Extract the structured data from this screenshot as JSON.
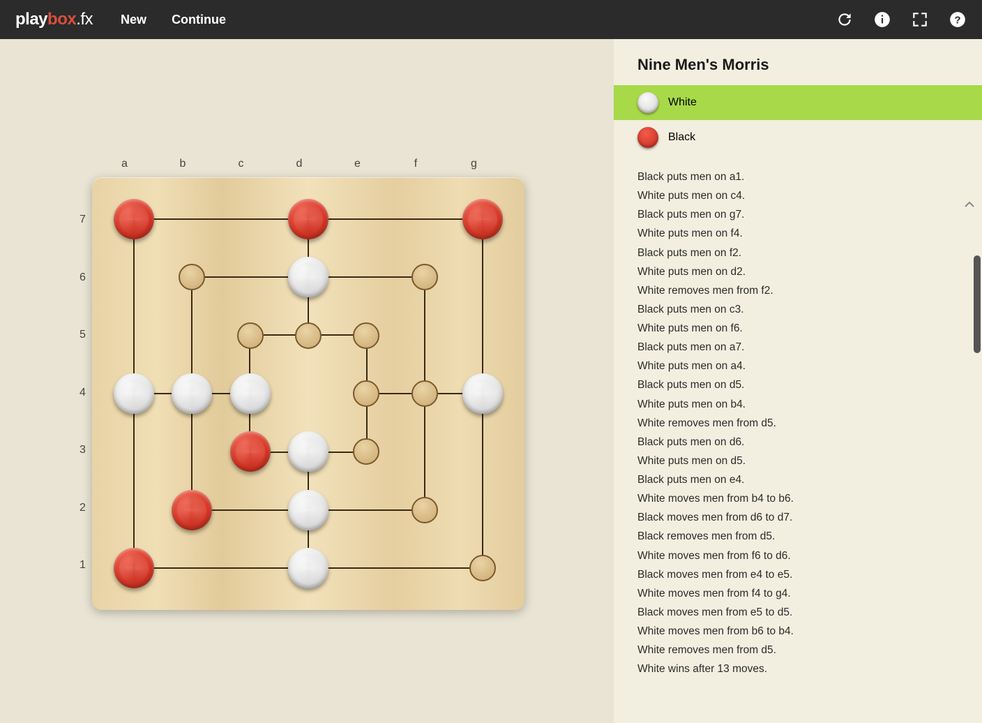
{
  "header": {
    "logo_play": "play",
    "logo_box": "box",
    "logo_fx": ".fx",
    "new_label": "New",
    "continue_label": "Continue"
  },
  "sidebar": {
    "title": "Nine Men's Morris",
    "white_label": "White",
    "black_label": "Black",
    "active_player": "white"
  },
  "log": [
    "Black puts men on a1.",
    "White puts men on c4.",
    "Black puts men on g7.",
    "White puts men on f4.",
    "Black puts men on f2.",
    "White puts men on d2.",
    "White removes men from f2.",
    "Black puts men on c3.",
    "White puts men on f6.",
    "Black puts men on a7.",
    "White puts men on a4.",
    "Black puts men on d5.",
    "White puts men on b4.",
    "White removes men from d5.",
    "Black puts men on d6.",
    "White puts men on d5.",
    "Black puts men on e4.",
    "White moves men from b4 to b6.",
    "Black moves men from d6 to d7.",
    "Black removes men from d5.",
    "White moves men from f6 to d6.",
    "Black moves men from e4 to e5.",
    "White moves men from f4 to g4.",
    "Black moves men from e5 to d5.",
    "White moves men from b6 to b4.",
    "White removes men from d5.",
    "White wins after 13 moves."
  ],
  "board": {
    "cols": [
      "a",
      "b",
      "c",
      "d",
      "e",
      "f",
      "g"
    ],
    "rows": [
      "7",
      "6",
      "5",
      "4",
      "3",
      "2",
      "1"
    ],
    "points": [
      {
        "id": "a7",
        "col": 0,
        "row": 0
      },
      {
        "id": "d7",
        "col": 3,
        "row": 0
      },
      {
        "id": "g7",
        "col": 6,
        "row": 0
      },
      {
        "id": "b6",
        "col": 1,
        "row": 1
      },
      {
        "id": "d6",
        "col": 3,
        "row": 1
      },
      {
        "id": "f6",
        "col": 5,
        "row": 1
      },
      {
        "id": "c5",
        "col": 2,
        "row": 2
      },
      {
        "id": "d5",
        "col": 3,
        "row": 2
      },
      {
        "id": "e5",
        "col": 4,
        "row": 2
      },
      {
        "id": "a4",
        "col": 0,
        "row": 3
      },
      {
        "id": "b4",
        "col": 1,
        "row": 3
      },
      {
        "id": "c4",
        "col": 2,
        "row": 3
      },
      {
        "id": "e4",
        "col": 4,
        "row": 3
      },
      {
        "id": "f4",
        "col": 5,
        "row": 3
      },
      {
        "id": "g4",
        "col": 6,
        "row": 3
      },
      {
        "id": "c3",
        "col": 2,
        "row": 4
      },
      {
        "id": "d3",
        "col": 3,
        "row": 4
      },
      {
        "id": "e3",
        "col": 4,
        "row": 4
      },
      {
        "id": "b2",
        "col": 1,
        "row": 5
      },
      {
        "id": "d2",
        "col": 3,
        "row": 5
      },
      {
        "id": "f2",
        "col": 5,
        "row": 5
      },
      {
        "id": "a1",
        "col": 0,
        "row": 6
      },
      {
        "id": "d1",
        "col": 3,
        "row": 6
      },
      {
        "id": "g1",
        "col": 6,
        "row": 6
      }
    ],
    "pieces": [
      {
        "at": "a7",
        "color": "red"
      },
      {
        "at": "d7",
        "color": "red"
      },
      {
        "at": "g7",
        "color": "red"
      },
      {
        "at": "d6",
        "color": "white"
      },
      {
        "at": "a4",
        "color": "white"
      },
      {
        "at": "b4",
        "color": "white"
      },
      {
        "at": "c4",
        "color": "white"
      },
      {
        "at": "g4",
        "color": "white"
      },
      {
        "at": "c3",
        "color": "red"
      },
      {
        "at": "d3",
        "color": "white"
      },
      {
        "at": "b2",
        "color": "red"
      },
      {
        "at": "d2",
        "color": "white"
      },
      {
        "at": "a1",
        "color": "red"
      },
      {
        "at": "d1",
        "color": "white"
      }
    ]
  }
}
